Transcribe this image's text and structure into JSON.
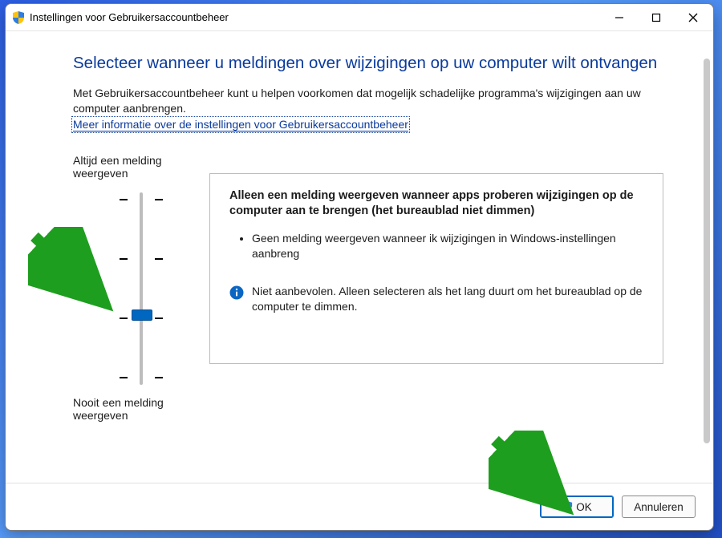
{
  "titlebar": {
    "title": "Instellingen voor Gebruikersaccountbeheer"
  },
  "main": {
    "heading": "Selecteer wanneer u meldingen over wijzigingen op uw computer wilt ontvangen",
    "intro": "Met Gebruikersaccountbeheer kunt u helpen voorkomen dat mogelijk schadelijke programma's wijzigingen aan uw computer aanbrengen.",
    "help_link": "Meer informatie over de instellingen voor Gebruikersaccountbeheer"
  },
  "slider": {
    "top_label": "Altijd een melding weergeven",
    "bottom_label": "Nooit een melding weergeven",
    "levels": 4,
    "selected_index": 2
  },
  "panel": {
    "title": "Alleen een melding weergeven wanneer apps proberen wijzigingen op de computer aan te brengen (het bureaublad niet dimmen)",
    "bullets": [
      "Geen melding weergeven wanneer ik wijzigingen in Windows-instellingen aanbreng"
    ],
    "info_text": "Niet aanbevolen. Alleen selecteren als het lang duurt om het bureaublad op de computer te dimmen."
  },
  "buttons": {
    "ok": "OK",
    "cancel": "Annuleren"
  }
}
